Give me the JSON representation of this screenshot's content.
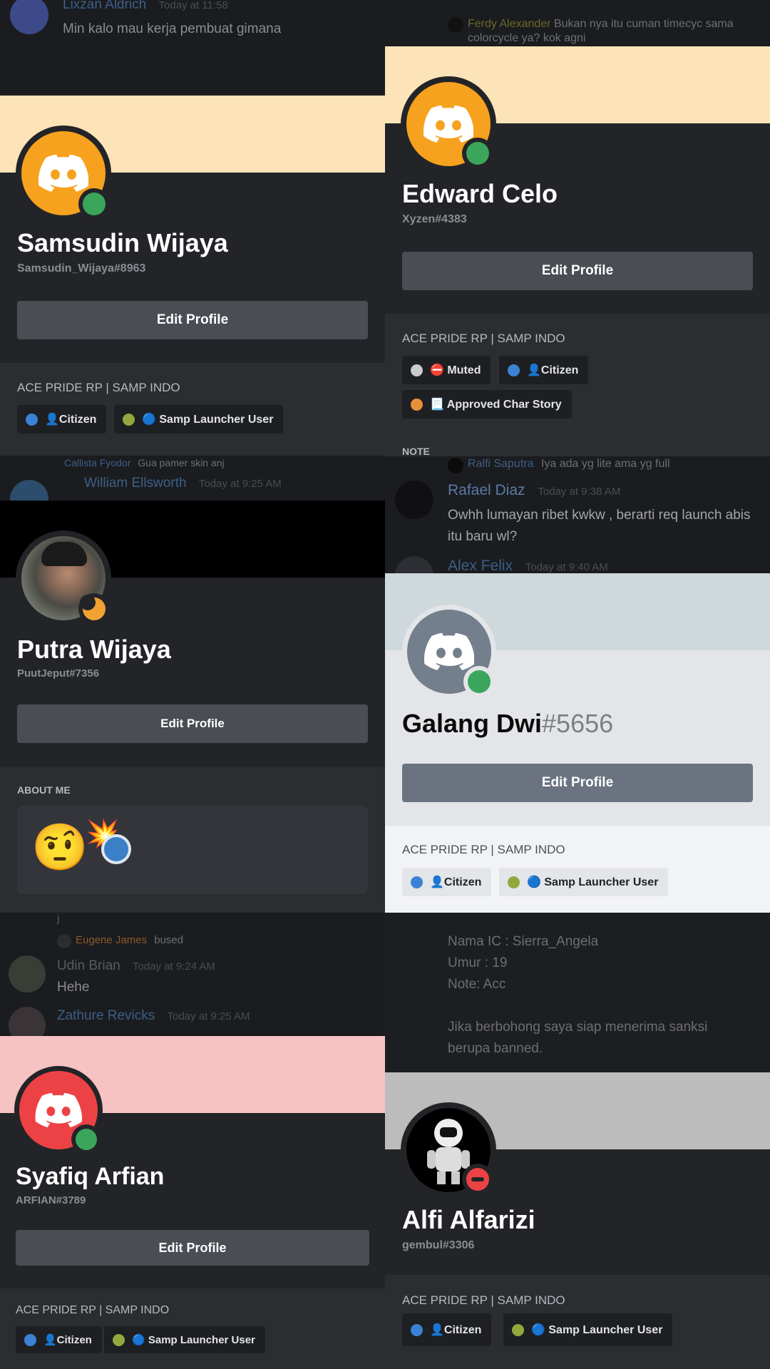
{
  "top_left_chat": {
    "name": "Lixzan Aldrich",
    "time": "Today at 11:58",
    "message": "Min kalo mau kerja pembuat gimana"
  },
  "top_right_chat": {
    "reply_name": "Ferdy Alexander",
    "reply_text": "Bukan nya itu cuman timecyc sama colorcycle ya? kok agni"
  },
  "profile1": {
    "display_name": "Samsudin Wijaya",
    "username": "Samsudin_Wijaya#8963",
    "edit_label": "Edit Profile",
    "server": "ACE PRIDE RP | SAMP INDO",
    "roles": [
      {
        "label": "👤Citizen",
        "color": "#3b82d6"
      },
      {
        "label": "🔵 Samp Launcher User",
        "color": "#93a83c"
      }
    ],
    "banner_color": "#fde3b8",
    "avatar_color": "#f6a21e",
    "status_color": "#3ba55c"
  },
  "profile2": {
    "display_name": "Edward Celo",
    "username": "Xyzen#4383",
    "edit_label": "Edit Profile",
    "server": "ACE PRIDE RP | SAMP INDO",
    "roles": [
      {
        "label": "⛔ Muted",
        "color": "#c9cbce"
      },
      {
        "label": "👤Citizen",
        "color": "#3b82d6"
      },
      {
        "label": "📃 Approved Char Story",
        "color": "#e7903c"
      }
    ],
    "note_label": "NOTE",
    "banner_color": "#fde3b8",
    "avatar_color": "#f6a21e",
    "status_color": "#3ba55c"
  },
  "middle_left_chat": {
    "reply_name": "Callista Fyodor",
    "reply_text": "Gua pamer skin anj",
    "name": "William Ellsworth",
    "time": "Today at 9:25 AM"
  },
  "middle_right_chat": {
    "reply_name": "Ralfi Saputra",
    "reply_text": "Iya ada yg lite ama yg full",
    "name": "Rafael Diaz",
    "time": "Today at 9:38 AM",
    "message": "Owhh  lumayan ribet kwkw , berarti req launch abis itu baru wl?",
    "name2": "Alex Felix",
    "time2": "Today at 9:40 AM"
  },
  "profile3": {
    "display_name": "Putra Wijaya",
    "username": "PuutJeput#7356",
    "edit_label": "Edit Profile",
    "about_label": "ABOUT ME",
    "about_emoji_1": "🤨",
    "about_emoji_2": "💥",
    "banner_color": "#000000",
    "status_color": "#f0a232"
  },
  "profile4": {
    "display_name": "Galang Dwi",
    "discriminator": "#5656",
    "edit_label": "Edit Profile",
    "server": "ACE PRIDE RP | SAMP INDO",
    "roles": [
      {
        "label": "👤Citizen",
        "color": "#3b82d6"
      },
      {
        "label": "🔵 Samp Launcher User",
        "color": "#93a83c"
      }
    ],
    "banner_color": "#cfd9db",
    "avatar_color": "#747f8d",
    "status_color": "#3ba55c"
  },
  "lower_left_chat": {
    "reply_name": "Eugene James",
    "reply_text": "bused",
    "name": "Udin Brian",
    "time": "Today at 9:24 AM",
    "message": "Hehe",
    "name2": "Zathure Revicks",
    "time2": "Today at 9:25 AM"
  },
  "lower_right_chat": {
    "lines": [
      "Nama IC : Sierra_Angela",
      "Umur : 19",
      "Note: Acc",
      "",
      "Jika  berbohong saya siap menerima sanksi",
      "berupa banned."
    ]
  },
  "profile5": {
    "display_name": "Syafiq Arfian",
    "username": "ARFIAN#3789",
    "edit_label": "Edit Profile",
    "server": "ACE PRIDE RP | SAMP INDO",
    "roles": [
      {
        "label": "👤Citizen",
        "color": "#3b82d6"
      },
      {
        "label": "🔵 Samp Launcher User",
        "color": "#93a83c"
      }
    ],
    "banner_color": "#f7c2c2",
    "avatar_color": "#ed4245",
    "status_color": "#3ba55c"
  },
  "profile6": {
    "display_name": "Alfi Alfarizi",
    "username": "gembul#3306",
    "server": "ACE PRIDE RP | SAMP INDO",
    "roles": [
      {
        "label": "👤Citizen",
        "color": "#3b82d6"
      },
      {
        "label": "🔵 Samp Launcher User",
        "color": "#93a83c"
      }
    ],
    "banner_color": "#bcbcbc",
    "status_color": "#ed4245"
  }
}
